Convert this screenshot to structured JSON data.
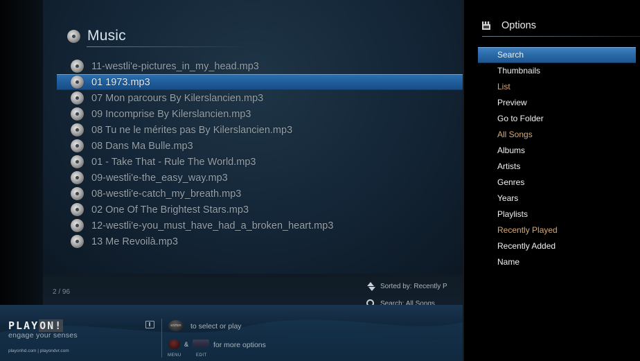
{
  "header": {
    "title": "Music"
  },
  "tracks": [
    {
      "name": "11-westli'e-pictures_in_my_head.mp3",
      "selected": false
    },
    {
      "name": "01 1973.mp3",
      "selected": true
    },
    {
      "name": "07 Mon parcours By Kilerslancien.mp3",
      "selected": false
    },
    {
      "name": "09 Incomprise By Kilerslancien.mp3",
      "selected": false
    },
    {
      "name": "08 Tu ne le mérites pas By Kilerslancien.mp3",
      "selected": false
    },
    {
      "name": "08 Dans Ma Bulle.mp3",
      "selected": false
    },
    {
      "name": "01 - Take That - Rule The World.mp3",
      "selected": false
    },
    {
      "name": "09-westli'e-the_easy_way.mp3",
      "selected": false
    },
    {
      "name": "08-westli'e-catch_my_breath.mp3",
      "selected": false
    },
    {
      "name": "02 One Of The Brightest Stars.mp3",
      "selected": false
    },
    {
      "name": "12-westli'e-you_must_have_had_a_broken_heart.mp3",
      "selected": false
    },
    {
      "name": "13 Me Revoilà.mp3",
      "selected": false
    }
  ],
  "status": {
    "page_count": "2 / 96",
    "sorted_by": "Sorted by: Recently P",
    "search": "Search: All Songs"
  },
  "branding": {
    "logo": "PLAYON!",
    "logo_main": "PLAY",
    "logo_accent": "ON!",
    "tagline": "engage your senses",
    "links": "playonhd.com | playondvr.com"
  },
  "help": {
    "enter_btn": "ENTER",
    "select_hint": "to select or play",
    "amp": "&",
    "options_hint": "for more options",
    "menu_label": "MENU",
    "edit_label": "EDIT"
  },
  "options": {
    "title": "Options",
    "items": [
      {
        "label": "Search",
        "state": "selected"
      },
      {
        "label": "Thumbnails",
        "state": "normal"
      },
      {
        "label": "List",
        "state": "accent"
      },
      {
        "label": "Preview",
        "state": "normal"
      },
      {
        "label": "Go to Folder",
        "state": "normal"
      },
      {
        "label": "All Songs",
        "state": "accent"
      },
      {
        "label": "Albums",
        "state": "normal"
      },
      {
        "label": "Artists",
        "state": "normal"
      },
      {
        "label": "Genres",
        "state": "normal"
      },
      {
        "label": "Years",
        "state": "normal"
      },
      {
        "label": "Playlists",
        "state": "normal"
      },
      {
        "label": "Recently Played",
        "state": "accent"
      },
      {
        "label": "Recently Added",
        "state": "normal"
      },
      {
        "label": "Name",
        "state": "normal"
      }
    ]
  },
  "colors": {
    "selection_blue": "#2a6aab",
    "accent_orange": "#d6a874",
    "panel_bg": "#15283a"
  }
}
